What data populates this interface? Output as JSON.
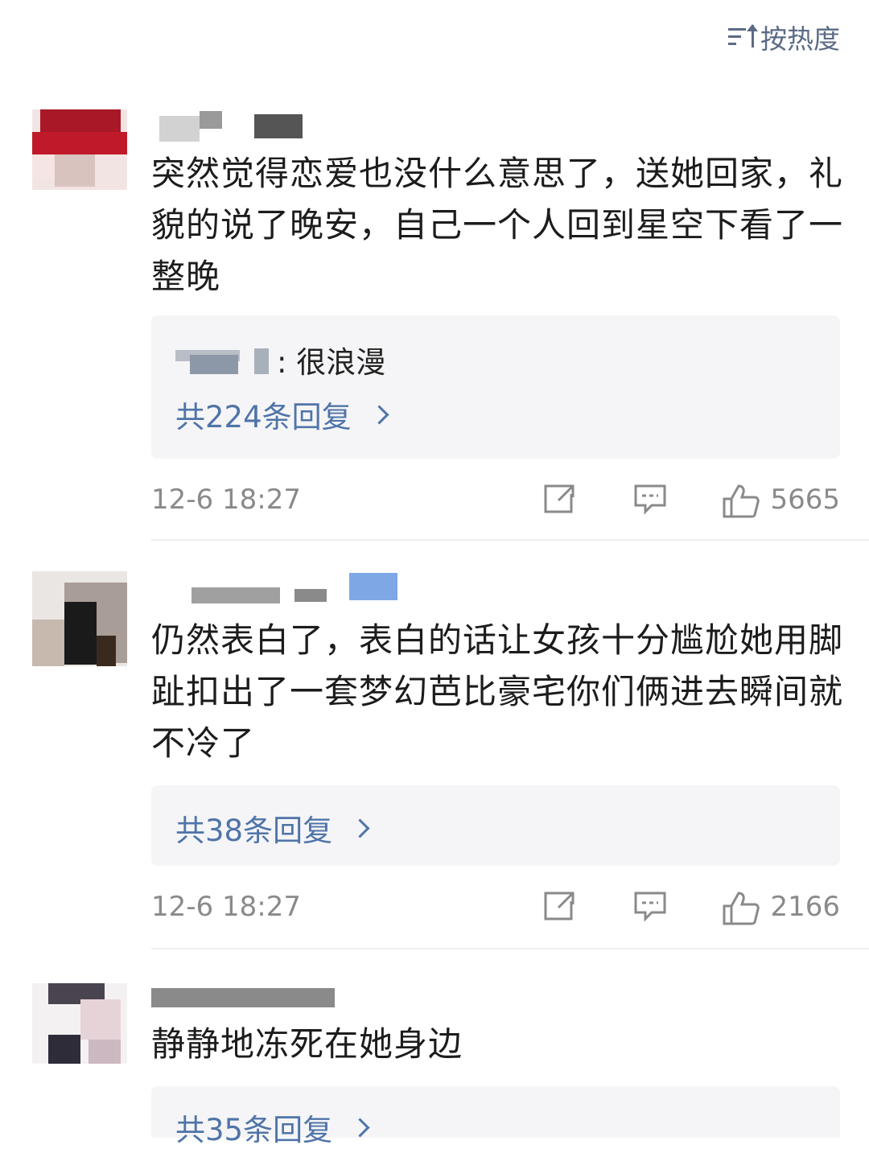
{
  "sort": {
    "label": "按热度"
  },
  "comments": [
    {
      "text": "突然觉得恋爱也没什么意思了，送她回家，礼貌的说了晚安，自己一个人回到星空下看了一整晚",
      "top_reply": ": 很浪漫",
      "reply_count": "共224条回复",
      "time": "12-6 18:27",
      "likes": "5665"
    },
    {
      "text": "仍然表白了，表白的话让女孩十分尴尬她用脚趾扣出了一套梦幻芭比豪宅你们俩进去瞬间就不冷了",
      "reply_count": "共38条回复",
      "time": "12-6 18:27",
      "likes": "2166"
    },
    {
      "text": "静静地冻死在她身边",
      "reply_count": "共35条回复"
    }
  ],
  "icons": [
    "sort-icon",
    "share-icon",
    "comment-icon",
    "like-icon",
    "chevron-right-icon"
  ],
  "colors": {
    "link": "#4f74a8",
    "meta": "#8a8a8a",
    "reply_bg": "#f5f5f7"
  }
}
